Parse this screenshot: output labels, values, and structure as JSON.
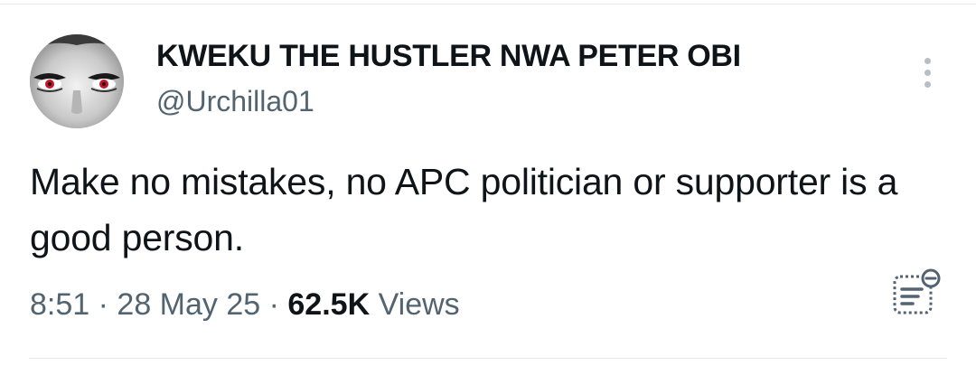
{
  "author": {
    "display_name": "KWEKU THE HUSTLER NWA PETER OBI",
    "handle": "@Urchilla01",
    "avatar_icon": "avatar-eyes-image"
  },
  "tweet": {
    "text": "Make no mistakes, no APC politician or supporter is a good person."
  },
  "meta": {
    "time": "8:51",
    "separator": " · ",
    "date": "28 May 25",
    "views_count": "62.5K",
    "views_label": " Views"
  },
  "icons": {
    "more": "more-vertical-icon",
    "analytics": "post-analytics-icon"
  },
  "colors": {
    "text": "#0f1419",
    "secondary_text": "#536471",
    "divider": "#e6e9eb",
    "icon_gray": "#b7bec4"
  }
}
